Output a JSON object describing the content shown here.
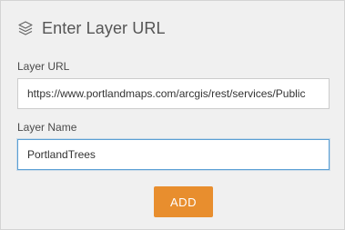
{
  "header": {
    "icon": "layers-icon",
    "title": "Enter Layer URL"
  },
  "form": {
    "layer_url": {
      "label": "Layer URL",
      "value": "https://www.portlandmaps.com/arcgis/rest/services/Public"
    },
    "layer_name": {
      "label": "Layer Name",
      "value": "PortlandTrees"
    },
    "add_button_label": "ADD"
  },
  "colors": {
    "panel_background": "#f0f0f0",
    "accent_button": "#e88e2e",
    "focus_border": "#5a9fd4"
  }
}
